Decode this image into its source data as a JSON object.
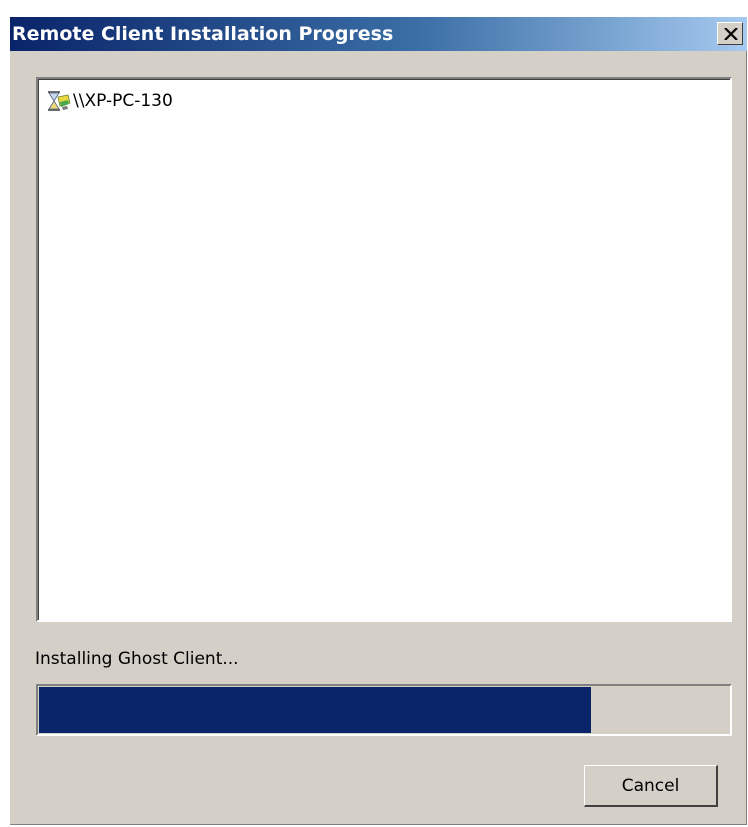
{
  "window": {
    "title": "Remote Client Installation Progress",
    "close_icon": "close-x-icon"
  },
  "list": {
    "items": [
      {
        "icon": "hourglass-computer-icon",
        "label": "\\\\XP-PC-130"
      }
    ]
  },
  "status": {
    "text": "Installing Ghost Client..."
  },
  "progress": {
    "fraction": 0.8,
    "fill_color": "#0a246a"
  },
  "buttons": {
    "cancel_label": "Cancel"
  },
  "colors": {
    "title_gradient_start": "#0a246a",
    "title_gradient_end": "#a6caf0",
    "dialog_face": "#d4d0c8"
  }
}
